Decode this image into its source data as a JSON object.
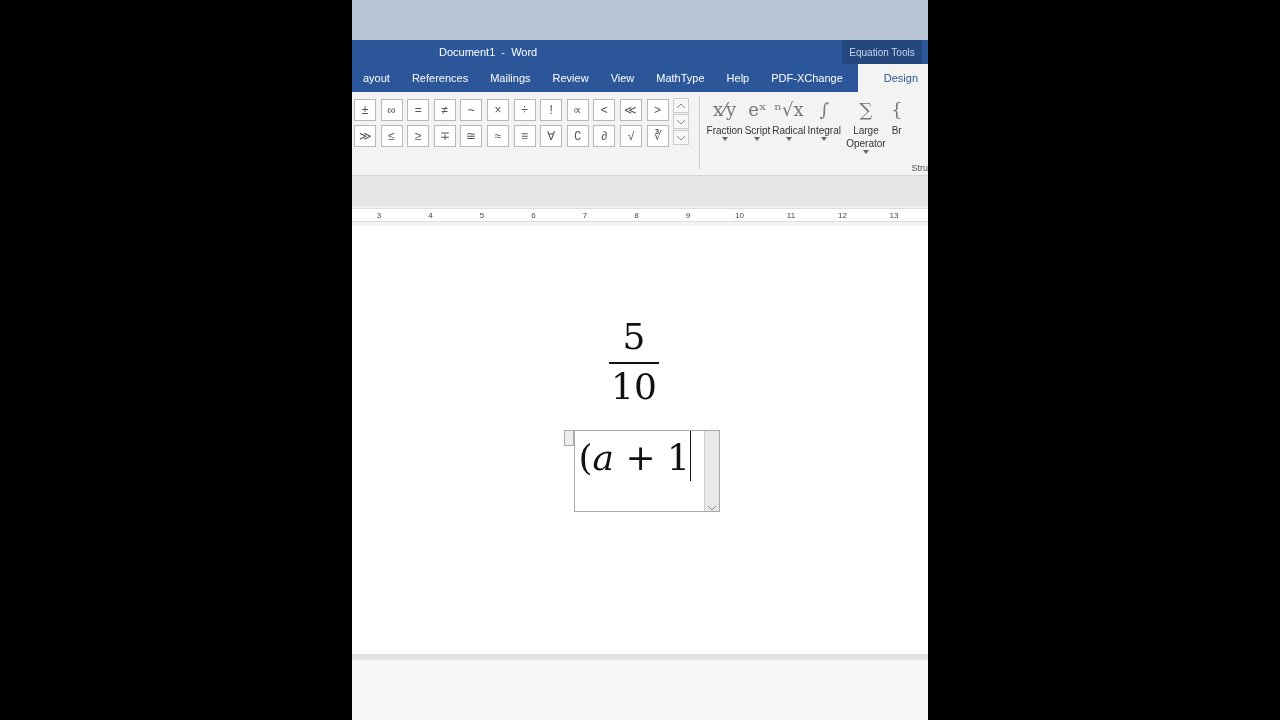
{
  "window": {
    "title": "Document1  -  Word",
    "context_tab_group": "Equation Tools"
  },
  "tabs": [
    {
      "label": "ayout",
      "selected": false
    },
    {
      "label": "References",
      "selected": false
    },
    {
      "label": "Mailings",
      "selected": false
    },
    {
      "label": "Review",
      "selected": false
    },
    {
      "label": "View",
      "selected": false
    },
    {
      "label": "MathType",
      "selected": false
    },
    {
      "label": "Help",
      "selected": false
    },
    {
      "label": "PDF-XChange",
      "selected": false
    },
    {
      "label": "Design",
      "selected": true
    }
  ],
  "symbols": [
    [
      "±",
      "∞",
      "=",
      "≠",
      "~",
      "×",
      "÷",
      "!",
      "∝",
      "<",
      "≪",
      ">"
    ],
    [
      "≫",
      "≤",
      "≥",
      "∓",
      "≅",
      "≈",
      "≡",
      "∀",
      "∁",
      "∂",
      "√",
      "∛"
    ]
  ],
  "structures": [
    {
      "glyph": "x⁄y",
      "label": "Fraction",
      "dropdown": true
    },
    {
      "glyph": "eˣ",
      "label": "Script",
      "dropdown": true
    },
    {
      "glyph": "ⁿ√x",
      "label": "Radical",
      "dropdown": true
    },
    {
      "glyph": "∫",
      "label": "Integral",
      "dropdown": true
    },
    {
      "glyph": "∑",
      "label": "Large Operator",
      "dropdown": true
    },
    {
      "glyph": "{",
      "label": "Br",
      "dropdown": false
    }
  ],
  "structures_group_label": "Stru",
  "ruler": [
    "3",
    "4",
    "5",
    "6",
    "7",
    "8",
    "9",
    "10",
    "11",
    "12",
    "13"
  ],
  "document": {
    "fraction": {
      "numerator": "5",
      "denominator": "10"
    },
    "equation": "(*a* + 1"
  }
}
